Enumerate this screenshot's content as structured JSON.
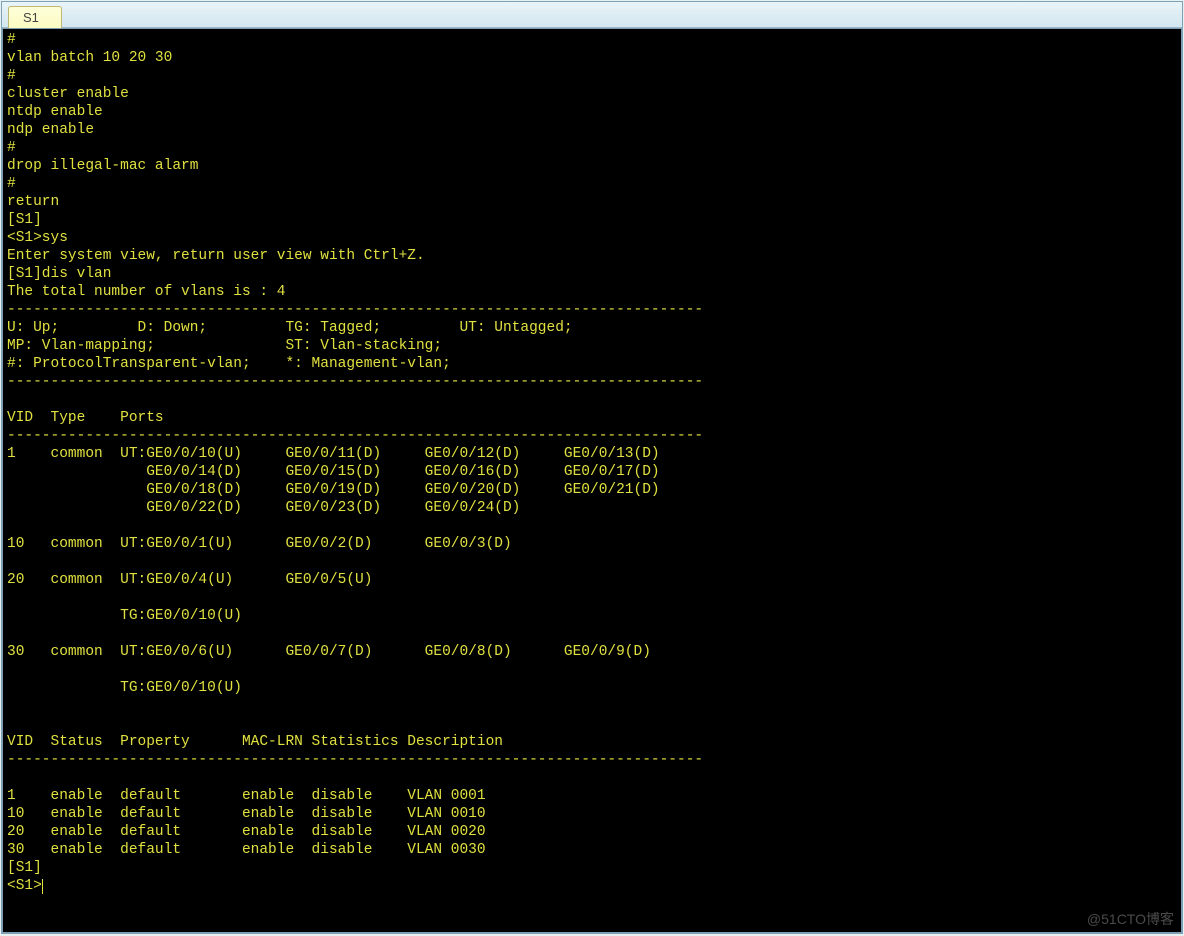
{
  "tab": {
    "label": "S1"
  },
  "terminal": {
    "lines": [
      "#",
      "vlan batch 10 20 30",
      "#",
      "cluster enable",
      "ntdp enable",
      "ndp enable",
      "#",
      "drop illegal-mac alarm",
      "#",
      "return",
      "[S1]",
      "<S1>sys",
      "Enter system view, return user view with Ctrl+Z.",
      "[S1]dis vlan",
      "The total number of vlans is : 4",
      "--------------------------------------------------------------------------------",
      "U: Up;         D: Down;         TG: Tagged;         UT: Untagged;",
      "MP: Vlan-mapping;               ST: Vlan-stacking;",
      "#: ProtocolTransparent-vlan;    *: Management-vlan;",
      "--------------------------------------------------------------------------------",
      "",
      "VID  Type    Ports",
      "--------------------------------------------------------------------------------",
      "1    common  UT:GE0/0/10(U)     GE0/0/11(D)     GE0/0/12(D)     GE0/0/13(D)",
      "                GE0/0/14(D)     GE0/0/15(D)     GE0/0/16(D)     GE0/0/17(D)",
      "                GE0/0/18(D)     GE0/0/19(D)     GE0/0/20(D)     GE0/0/21(D)",
      "                GE0/0/22(D)     GE0/0/23(D)     GE0/0/24(D)",
      "",
      "10   common  UT:GE0/0/1(U)      GE0/0/2(D)      GE0/0/3(D)",
      "",
      "20   common  UT:GE0/0/4(U)      GE0/0/5(U)",
      "",
      "             TG:GE0/0/10(U)",
      "",
      "30   common  UT:GE0/0/6(U)      GE0/0/7(D)      GE0/0/8(D)      GE0/0/9(D)",
      "",
      "             TG:GE0/0/10(U)",
      "",
      "",
      "VID  Status  Property      MAC-LRN Statistics Description",
      "--------------------------------------------------------------------------------",
      "",
      "1    enable  default       enable  disable    VLAN 0001",
      "10   enable  default       enable  disable    VLAN 0010",
      "20   enable  default       enable  disable    VLAN 0020",
      "30   enable  default       enable  disable    VLAN 0030",
      "[S1]"
    ],
    "prompt": "<S1>"
  },
  "watermark": "@51CTO博客"
}
